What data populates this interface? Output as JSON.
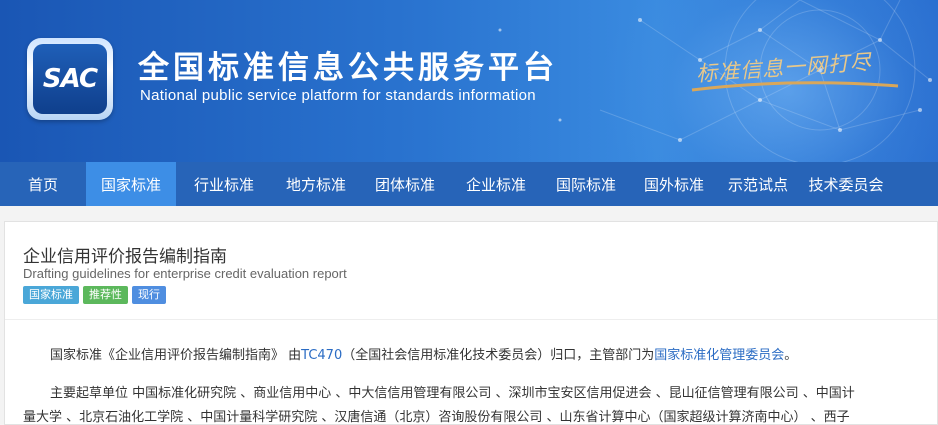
{
  "header": {
    "logo_text": "SAC",
    "title_cn": "全国标准信息公共服务平台",
    "title_en": "National public service platform  for standards information",
    "slogan": "标准信息一网打尽"
  },
  "nav": {
    "items": [
      {
        "label": "首页"
      },
      {
        "label": "国家标准"
      },
      {
        "label": "行业标准"
      },
      {
        "label": "地方标准"
      },
      {
        "label": "团体标准"
      },
      {
        "label": "企业标准"
      },
      {
        "label": "国际标准"
      },
      {
        "label": "国外标准"
      },
      {
        "label": "示范试点"
      },
      {
        "label": "技术委员会"
      }
    ],
    "active": "国家标准"
  },
  "document": {
    "title": "企业信用评价报告编制指南",
    "subtitle": "Drafting guidelines for enterprise credit evaluation report",
    "tags": [
      "国家标准",
      "推荐性",
      "现行"
    ],
    "para1": {
      "prefix": "国家标准《企业信用评价报告编制指南》 由",
      "committee_code": "TC470",
      "middle": "（全国社会信用标准化技术委员会）归口，主管部门为",
      "authority": "国家标准化管理委员会",
      "suffix": "。"
    },
    "para2": {
      "line1": "主要起草单位 中国标准化研究院 、商业信用中心 、中大信信用管理有限公司 、深圳市宝安区信用促进会 、昆山征信管理有限公司 、中国计",
      "line2": "量大学 、北京石油化工学院 、中国计量科学研究院 、汉唐信通（北京）咨询股份有限公司 、山东省计算中心（国家超级计算济南中心） 、西子"
    }
  }
}
